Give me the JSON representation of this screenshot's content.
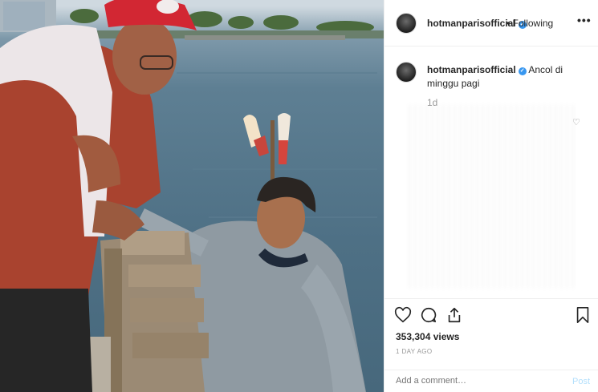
{
  "post": {
    "username": "hotmanparisofficial",
    "verified_icon": "verified-badge-icon",
    "follow_status": "• Following",
    "more_options": "•••",
    "caption_text": "Ancol di minggu pagi",
    "age": "1d",
    "views": "353,304 views",
    "time_ago": "1 DAY AGO",
    "comment_placeholder": "Add a comment…",
    "post_label": "Post"
  },
  "icons": {
    "like": "heart-icon",
    "comment": "comment-icon",
    "share": "share-icon",
    "save": "bookmark-icon",
    "verified": "check-icon",
    "comment_like": "heart-small-icon"
  },
  "colors": {
    "verified_blue": "#3897f0",
    "post_disabled": "#b2dffc",
    "border": "#efefef",
    "text": "#262626",
    "muted": "#999999"
  }
}
